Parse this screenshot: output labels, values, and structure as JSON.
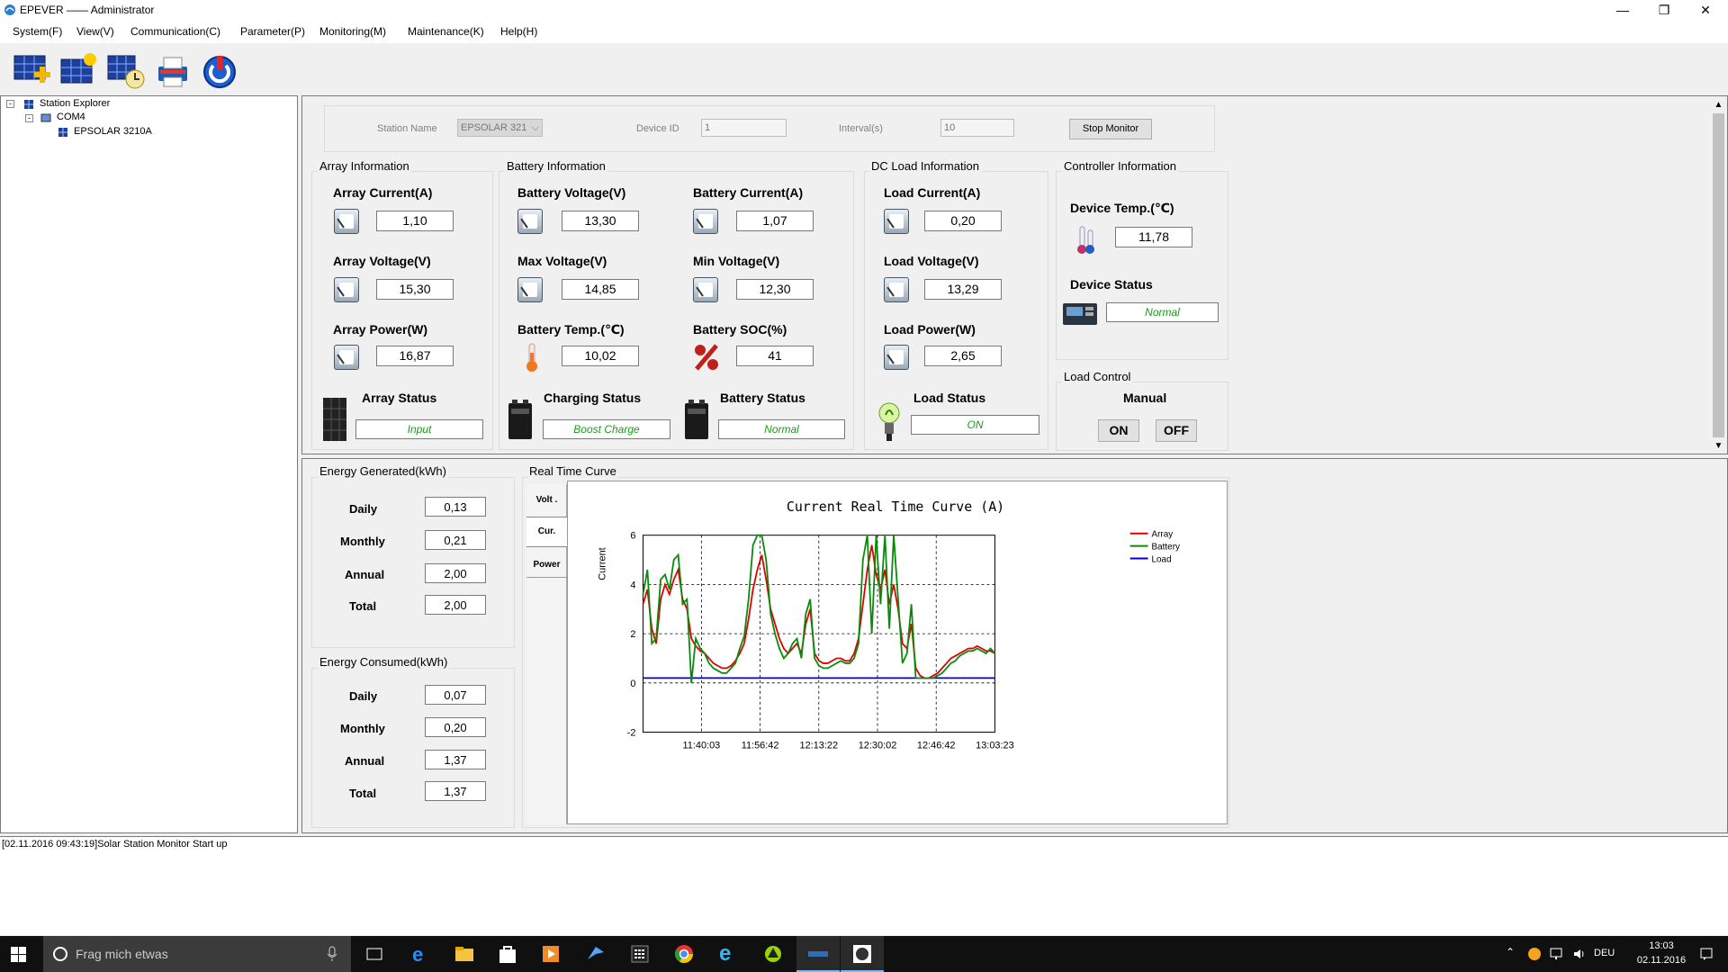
{
  "window": {
    "title": "EPEVER —— Administrator"
  },
  "menu": [
    "System(F)",
    "View(V)",
    "Communication(C)",
    "Parameter(P)",
    "Monitoring(M)",
    "Maintenance(K)",
    "Help(H)"
  ],
  "explorer": {
    "root": "Station Explorer",
    "port": "COM4",
    "device": "EPSOLAR 3210A"
  },
  "station": {
    "station_name_label": "Station Name",
    "station_name_value": "EPSOLAR 321",
    "device_id_label": "Device ID",
    "device_id_value": "1",
    "interval_label": "Interval(s)",
    "interval_value": "10",
    "stop_button": "Stop Monitor"
  },
  "array": {
    "title": "Array Information",
    "current_label": "Array Current(A)",
    "current": "1,10",
    "voltage_label": "Array Voltage(V)",
    "voltage": "15,30",
    "power_label": "Array Power(W)",
    "power": "16,87",
    "status_label": "Array Status",
    "status": "Input"
  },
  "battery": {
    "title": "Battery Information",
    "voltage_label": "Battery Voltage(V)",
    "voltage": "13,30",
    "current_label": "Battery Current(A)",
    "current": "1,07",
    "max_label": "Max Voltage(V)",
    "max": "14,85",
    "min_label": "Min Voltage(V)",
    "min": "12,30",
    "temp_label": "Battery Temp.(℃)",
    "temp": "10,02",
    "soc_label": "Battery SOC(%)",
    "soc": "41",
    "charging_label": "Charging Status",
    "charging": "Boost Charge",
    "status_label": "Battery Status",
    "status": "Normal"
  },
  "load": {
    "title": "DC Load Information",
    "current_label": "Load Current(A)",
    "current": "0,20",
    "voltage_label": "Load Voltage(V)",
    "voltage": "13,29",
    "power_label": "Load Power(W)",
    "power": "2,65",
    "status_label": "Load Status",
    "status": "ON"
  },
  "controller": {
    "title": "Controller Information",
    "temp_label": "Device Temp.(℃)",
    "temp": "11,78",
    "status_label": "Device Status",
    "status": "Normal"
  },
  "load_control": {
    "title": "Load Control",
    "mode": "Manual",
    "on": "ON",
    "off": "OFF"
  },
  "energy_generated": {
    "title": "Energy Generated(kWh)",
    "rows": [
      {
        "label": "Daily",
        "value": "0,13"
      },
      {
        "label": "Monthly",
        "value": "0,21"
      },
      {
        "label": "Annual",
        "value": "2,00"
      },
      {
        "label": "Total",
        "value": "2,00"
      }
    ]
  },
  "energy_consumed": {
    "title": "Energy Consumed(kWh)",
    "rows": [
      {
        "label": "Daily",
        "value": "0,07"
      },
      {
        "label": "Monthly",
        "value": "0,20"
      },
      {
        "label": "Annual",
        "value": "1,37"
      },
      {
        "label": "Total",
        "value": "1,37"
      }
    ]
  },
  "realtime": {
    "title": "Real Time Curve",
    "tabs": [
      "Volt .",
      "Cur.",
      "Power"
    ]
  },
  "chart_data": {
    "type": "line",
    "title": "Current Real Time Curve (A)",
    "ylabel": "Current",
    "xlabel": "",
    "ylim": [
      -2,
      6
    ],
    "y_ticks": [
      "6",
      "4",
      "2",
      "0",
      "-2"
    ],
    "x_ticks": [
      "11:40:03",
      "11:56:42",
      "12:13:22",
      "12:30:02",
      "12:46:42",
      "13:03:23"
    ],
    "legend_position": "top-right",
    "grid": true,
    "series": [
      {
        "name": "Array",
        "color": "#e00000",
        "values": [
          3.2,
          3.8,
          2.2,
          1.6,
          3.4,
          4.0,
          3.6,
          4.2,
          4.6,
          3.4,
          3.0,
          1.8,
          1.5,
          1.3,
          1.2,
          1.0,
          0.8,
          0.7,
          0.6,
          0.6,
          0.7,
          0.9,
          1.2,
          1.6,
          2.6,
          3.8,
          4.6,
          5.2,
          4.2,
          3.0,
          2.4,
          1.8,
          1.4,
          1.2,
          1.4,
          1.6,
          1.2,
          2.4,
          3.0,
          1.2,
          0.9,
          0.8,
          0.8,
          0.9,
          1.0,
          1.0,
          0.9,
          0.9,
          1.2,
          1.8,
          3.2,
          4.6,
          5.6,
          4.4,
          3.8,
          4.6,
          3.2,
          4.0,
          3.0,
          1.6,
          1.4,
          2.4,
          0.6,
          0.3,
          0.2,
          0.2,
          0.3,
          0.4,
          0.6,
          0.8,
          1.0,
          1.1,
          1.2,
          1.3,
          1.4,
          1.4,
          1.5,
          1.4,
          1.3,
          1.3,
          1.2
        ]
      },
      {
        "name": "Battery",
        "color": "#0a8a0a",
        "values": [
          3.6,
          4.6,
          1.6,
          1.8,
          4.2,
          4.4,
          3.8,
          5.0,
          5.2,
          3.2,
          3.4,
          0.0,
          1.8,
          1.4,
          1.2,
          0.8,
          0.6,
          0.5,
          0.4,
          0.4,
          0.6,
          0.8,
          1.4,
          1.9,
          3.4,
          5.6,
          6.0,
          6.0,
          5.0,
          2.8,
          2.0,
          1.4,
          1.0,
          1.2,
          1.6,
          1.8,
          1.0,
          2.8,
          3.4,
          1.0,
          0.7,
          0.6,
          0.6,
          0.7,
          0.8,
          0.9,
          0.8,
          0.8,
          1.0,
          1.6,
          5.0,
          6.0,
          2.0,
          6.0,
          3.2,
          6.0,
          2.2,
          6.0,
          3.4,
          0.8,
          1.2,
          3.2,
          0.2,
          0.2,
          0.2,
          0.2,
          0.2,
          0.3,
          0.4,
          0.6,
          0.8,
          0.9,
          1.1,
          1.2,
          1.3,
          1.3,
          1.4,
          1.3,
          1.2,
          1.4,
          1.2
        ]
      },
      {
        "name": "Load",
        "color": "#0000d0",
        "values": [
          0.2,
          0.2,
          0.2,
          0.2,
          0.2,
          0.2,
          0.2,
          0.2,
          0.2,
          0.2,
          0.2,
          0.2,
          0.2,
          0.2,
          0.2,
          0.2,
          0.2,
          0.2,
          0.2,
          0.2,
          0.2,
          0.2,
          0.2,
          0.2,
          0.2,
          0.2,
          0.2,
          0.2,
          0.2,
          0.2,
          0.2,
          0.2,
          0.2,
          0.2,
          0.2,
          0.2,
          0.2,
          0.2,
          0.2,
          0.2,
          0.2,
          0.2,
          0.2,
          0.2,
          0.2,
          0.2,
          0.2,
          0.2,
          0.2,
          0.2,
          0.2,
          0.2,
          0.2,
          0.2,
          0.2,
          0.2,
          0.2,
          0.2,
          0.2,
          0.2,
          0.2,
          0.2,
          0.2,
          0.2,
          0.2,
          0.2,
          0.2,
          0.2,
          0.2,
          0.2,
          0.2,
          0.2,
          0.2,
          0.2,
          0.2,
          0.2,
          0.2,
          0.2,
          0.2,
          0.2,
          0.2
        ]
      }
    ]
  },
  "log": {
    "line": "[02.11.2016 09:43:19]Solar Station Monitor Start up"
  },
  "taskbar": {
    "search_placeholder": "Frag mich etwas",
    "lang": "DEU",
    "time": "13:03",
    "date": "02.11.2016"
  },
  "colors": {
    "status_green": "#1a9c1a",
    "accent": "#0078d7"
  }
}
